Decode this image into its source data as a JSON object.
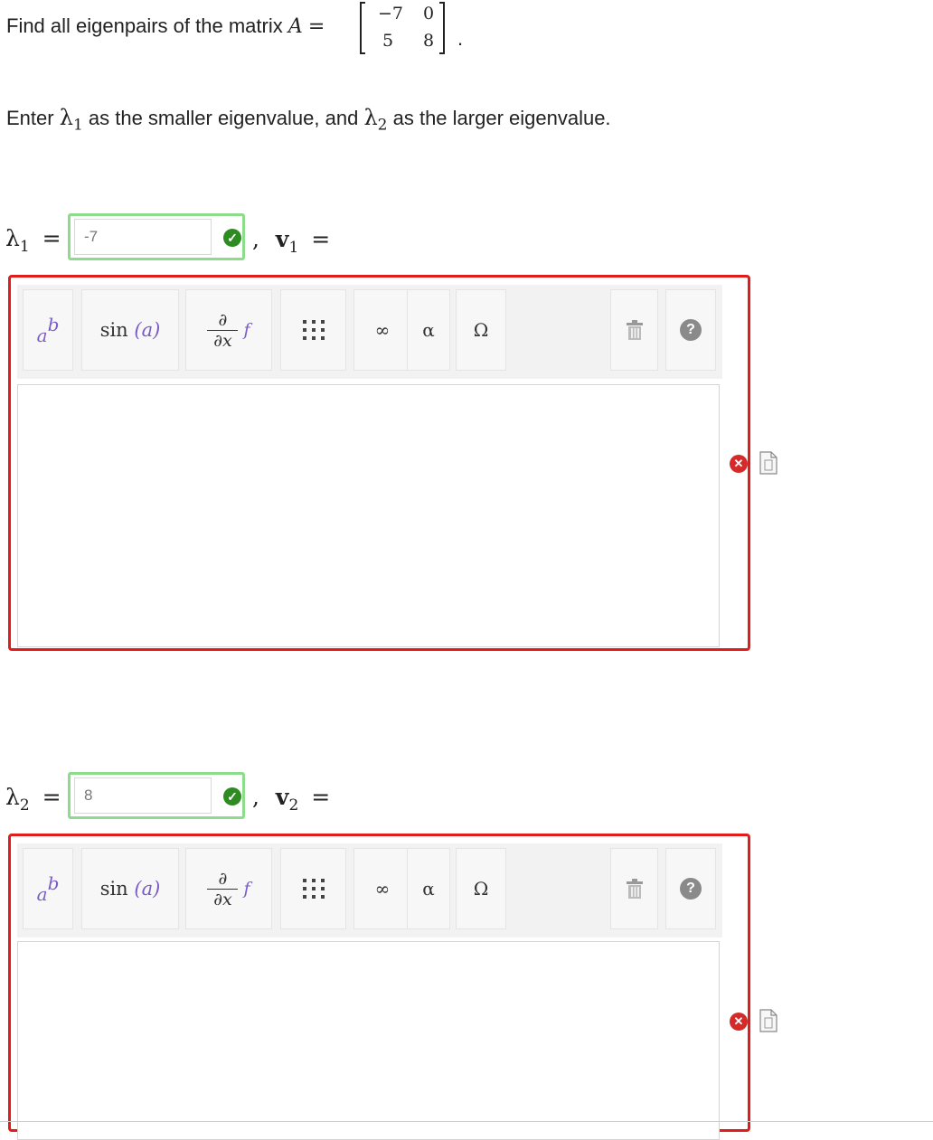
{
  "question": {
    "prefix": "Find all eigenpairs of the matrix",
    "var": "A",
    "eq": "=",
    "matrix": [
      [
        "−7",
        "0"
      ],
      [
        "5",
        "8"
      ]
    ],
    "period": "."
  },
  "instruction": {
    "part1": "Enter",
    "lam": "λ",
    "sub1": "1",
    "part2": "as the smaller eigenvalue, and",
    "sub2": "2",
    "part3": "as the larger eigenvalue."
  },
  "rows": [
    {
      "lam": "λ",
      "sub": "1",
      "eq": "=",
      "value": "-7",
      "status": "correct",
      "comma": ",",
      "vec": "v",
      "vec_sub": "1",
      "vec_eq": "="
    },
    {
      "lam": "λ",
      "sub": "2",
      "eq": "=",
      "value": "8",
      "status": "correct",
      "comma": ",",
      "vec": "v",
      "vec_sub": "2",
      "vec_eq": "="
    }
  ],
  "toolbar": {
    "sin": "sin",
    "sin_arg": "(a)",
    "deriv_top": "∂",
    "deriv_bot": "∂x",
    "deriv_f": "f",
    "infinity": "∞",
    "alpha": "α",
    "omega": "Ω",
    "help": "?"
  },
  "colors": {
    "correct": "#2e8b22",
    "incorrect": "#d42a2a",
    "editor_border": "#e21b1b",
    "answer_border": "#8ddc8b"
  },
  "icons": [
    "check-icon",
    "x-icon",
    "trash-icon",
    "help-icon",
    "matrix-grid-icon",
    "document-icon"
  ]
}
